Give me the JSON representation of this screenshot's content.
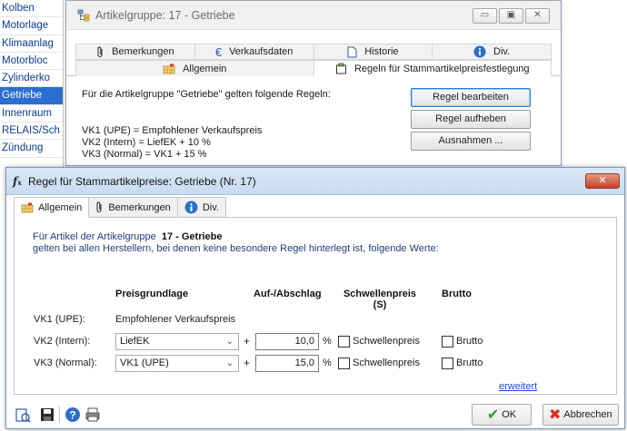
{
  "left_list": {
    "items": [
      "Kolben",
      "Motorlage",
      "Klimaanlag",
      "Motorbloc",
      "Zylinderko",
      "Getriebe",
      "Innenraum",
      "RELAIS/Sch",
      "Zündung"
    ],
    "selected_index": 5
  },
  "back_window": {
    "title": "Artikelgruppe: 17 - Getriebe",
    "tabs_row1": [
      "Bemerkungen",
      "Verkaufsdaten",
      "Historie",
      "Div."
    ],
    "tabs_row2": [
      "Allgemein",
      "Regeln für Stammartikelpreisfestlegung"
    ],
    "intro": "Für die Artikelgruppe \"Getriebe\" gelten folgende Regeln:",
    "rules": [
      "VK1 (UPE) = Empfohlener Verkaufspreis",
      "VK2 (Intern) = LiefEK + 10 %",
      "VK3 (Normal) = VK1 + 15 %"
    ],
    "buttons": {
      "edit": "Regel bearbeiten",
      "cancel_rule": "Regel aufheben",
      "exceptions": "Ausnahmen ..."
    }
  },
  "dialog": {
    "title": "Regel für Stammartikelpreise: Getriebe (Nr. 17)",
    "close_label": "✕",
    "tabs": [
      "Allgemein",
      "Bemerkungen",
      "Div."
    ],
    "intro_prefix": "Für Artikel der Artikelgruppe",
    "intro_group": "17 - Getriebe",
    "intro_line2": "gelten bei allen Herstellern, bei denen keine besondere Regel hinterlegt ist, folgende Werte:",
    "headers": {
      "basis": "Preisgrundlage",
      "markup": "Auf-/Abschlag",
      "threshold": "Schwellenpreis",
      "threshold_sub": "(S)",
      "gross": "Brutto"
    },
    "rows": [
      {
        "label": "VK1 (UPE):",
        "basis": "Empfohlener Verkaufspreis"
      },
      {
        "label": "VK2 (Intern):",
        "basis": "LiefEK",
        "plus": "+",
        "value": "10,0",
        "unit": "%",
        "threshold_label": "Schwellenpreis",
        "gross_label": "Brutto"
      },
      {
        "label": "VK3 (Normal):",
        "basis": "VK1 (UPE)",
        "plus": "+",
        "value": "15,0",
        "unit": "%",
        "threshold_label": "Schwellenpreis",
        "gross_label": "Brutto"
      }
    ],
    "extended_link": "erweitert",
    "ok_label": "OK",
    "cancel_label": "Abbrechen"
  },
  "colors": {
    "selection": "#2a6ecf",
    "link": "#1a4fd1",
    "dialog_title_bar": "#c8dbf1",
    "close_button": "#c4412a"
  }
}
